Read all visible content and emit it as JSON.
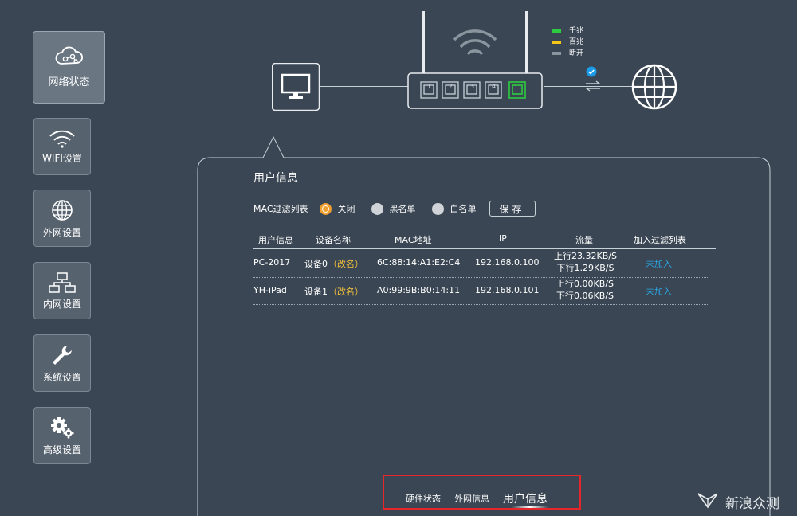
{
  "sidebar": {
    "items": [
      {
        "label": "网络状态",
        "icon": "cloud-network-icon",
        "active": true
      },
      {
        "label": "WIFI设置",
        "icon": "wifi-icon"
      },
      {
        "label": "外网设置",
        "icon": "globe-icon"
      },
      {
        "label": "内网设置",
        "icon": "lan-network-icon"
      },
      {
        "label": "系统设置",
        "icon": "wrench-icon"
      },
      {
        "label": "高级设置",
        "icon": "gears-icon"
      }
    ]
  },
  "legend": {
    "items": [
      {
        "label": "千兆",
        "color": "#2ecc40"
      },
      {
        "label": "百兆",
        "color": "#f5c518"
      },
      {
        "label": "断开",
        "color": "#8a959f"
      }
    ]
  },
  "router": {
    "ports": [
      "1",
      "2",
      "3",
      "4"
    ],
    "active_port_color": "#2ecc40",
    "connected_color": "#1a9be8"
  },
  "panel": {
    "title": "用户信息",
    "mac_filter": {
      "label": "MAC过滤列表",
      "options": [
        {
          "label": "关闭",
          "checked": true
        },
        {
          "label": "黑名单",
          "checked": false
        },
        {
          "label": "白名单",
          "checked": false
        }
      ],
      "save_label": "保存"
    },
    "table": {
      "headers": [
        "用户信息",
        "设备名称",
        "MAC地址",
        "IP",
        "流量",
        "加入过滤列表"
      ],
      "rows": [
        {
          "user": "PC-2017",
          "device": "设备0",
          "rename": "（改名）",
          "mac": "6C:88:14:A1:E2:C4",
          "ip": "192.168.0.100",
          "up": "上行23.32KB/S",
          "down": "下行1.29KB/S",
          "filter": "未加入"
        },
        {
          "user": "YH-iPad",
          "device": "设备1",
          "rename": "（改名）",
          "mac": "A0:99:9B:B0:14:11",
          "ip": "192.168.0.101",
          "up": "上行0.00KB/S",
          "down": "下行0.06KB/S",
          "filter": "未加入"
        }
      ]
    }
  },
  "tabs": {
    "items": [
      {
        "label": "硬件状态"
      },
      {
        "label": "外网信息"
      },
      {
        "label": "用户信息",
        "active": true
      }
    ],
    "highlight_color": "#e5262a"
  },
  "watermark": {
    "text": "新浪众测"
  }
}
